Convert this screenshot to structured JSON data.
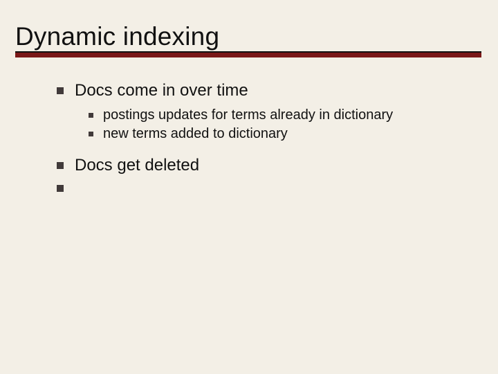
{
  "slide": {
    "title": "Dynamic indexing",
    "bullets": {
      "b1": "Docs come in over time",
      "b1a": "postings updates for terms already in dictionary",
      "b1b": "new terms added to dictionary",
      "b2": "Docs get deleted",
      "b3": ""
    }
  }
}
